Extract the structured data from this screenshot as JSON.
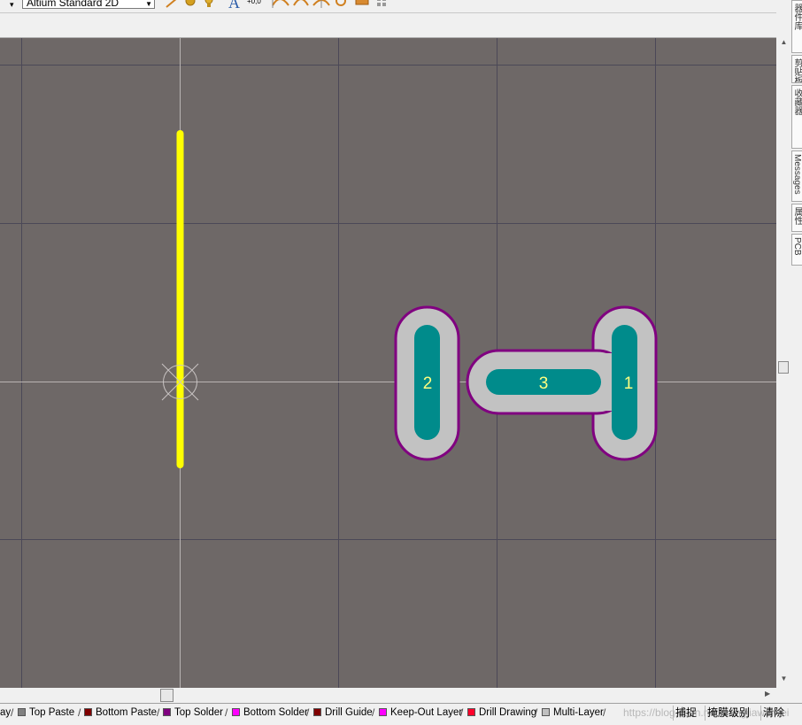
{
  "toolbar": {
    "view_select_value": "Altium Standard 2D",
    "text_tool_glyph": "A",
    "coord_tool_glyph": "+0,0"
  },
  "side_panel": {
    "tabs": [
      "器件库",
      "剪贴板",
      "收藏器",
      "Messages",
      "属性",
      "PCB"
    ]
  },
  "pcb": {
    "pads": [
      {
        "designator": "2"
      },
      {
        "designator": "3"
      },
      {
        "designator": "1"
      }
    ],
    "colors": {
      "canvas_bg": "#6e6867",
      "grid_line": "#4b4857",
      "crosshair": "#b9b4b3",
      "track": "#ffff00",
      "pad_copper": "#008b8b",
      "solder_mask_fill": "#c2c2c2",
      "solder_mask_outline": "#800080",
      "pad_label": "#ffff80"
    }
  },
  "layer_tabs": [
    {
      "label": "ay",
      "color": ""
    },
    {
      "label": "Top Paste",
      "color": "#808080"
    },
    {
      "label": "Bottom Paste",
      "color": "#800000"
    },
    {
      "label": "Top Solder",
      "color": "#800080"
    },
    {
      "label": "Bottom Solder",
      "color": "#ff00ff"
    },
    {
      "label": "Drill Guide",
      "color": "#800000"
    },
    {
      "label": "Keep-Out Layer",
      "color": "#ff00ff"
    },
    {
      "label": "Drill Drawing",
      "color": "#ff002a"
    },
    {
      "label": "Multi-Layer",
      "color": "#c0c0c0"
    }
  ],
  "status_buttons": {
    "snap": "捕捉",
    "mask_level": "掩膜级别",
    "clear": "清除"
  },
  "watermark": "https://blog.csdn.net/wangjiaweiwei"
}
